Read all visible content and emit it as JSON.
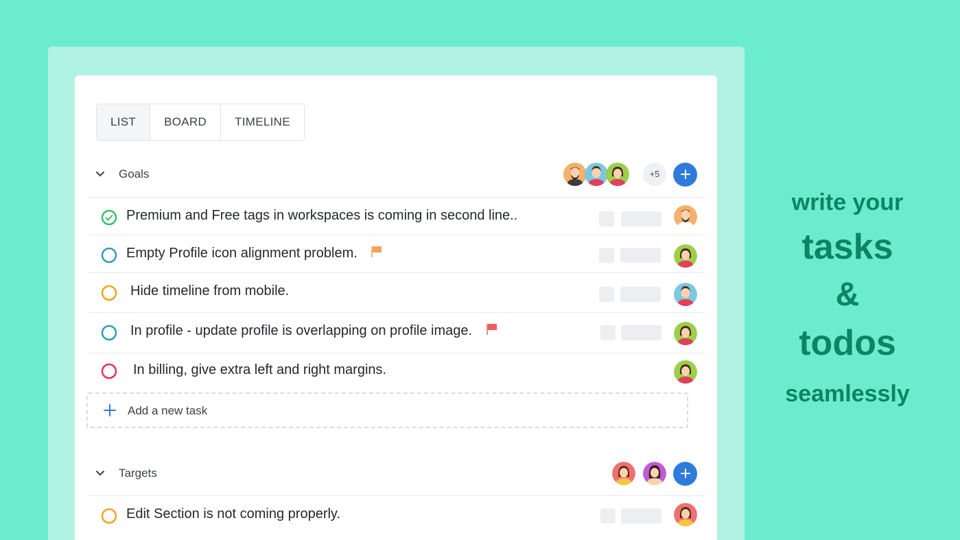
{
  "view_tabs": [
    {
      "label": "LIST",
      "active": true
    },
    {
      "label": "BOARD",
      "active": false
    },
    {
      "label": "TIMELINE",
      "active": false
    }
  ],
  "sections": [
    {
      "title": "Goals",
      "more_members": "+5",
      "tasks": [
        {
          "text": "Premium and Free tags in workspaces is coming in second line..",
          "status": "completed",
          "status_color": "#3dbd6e",
          "flag": null
        },
        {
          "text": "Empty Profile icon alignment problem.",
          "status": "open",
          "status_color": "#2e9cb8",
          "flag": "#f5a05c"
        },
        {
          "text": "Hide timeline from mobile.",
          "status": "open",
          "status_color": "#f2a31b",
          "flag": null
        },
        {
          "text": "In profile - update profile is overlapping on profile image.",
          "status": "open",
          "status_color": "#2e9cb8",
          "flag": "#f05c5c"
        },
        {
          "text": "In billing, give extra left and right margins.",
          "status": "open",
          "status_color": "#ea2f5a",
          "flag": null
        }
      ],
      "add_task_label": "Add a new task"
    },
    {
      "title": "Targets",
      "tasks": [
        {
          "text": "Edit Section is not coming properly.",
          "status": "open",
          "status_color": "#f2a31b",
          "flag": null
        }
      ]
    }
  ],
  "tagline": {
    "line1": "write your",
    "line2": "tasks",
    "line3": "&",
    "line4": "todos",
    "line5": "seamlessly"
  },
  "colors": {
    "background": "#6ceccf",
    "accent_blue": "#2f7bdc",
    "tagline_green": "#0d8463"
  }
}
